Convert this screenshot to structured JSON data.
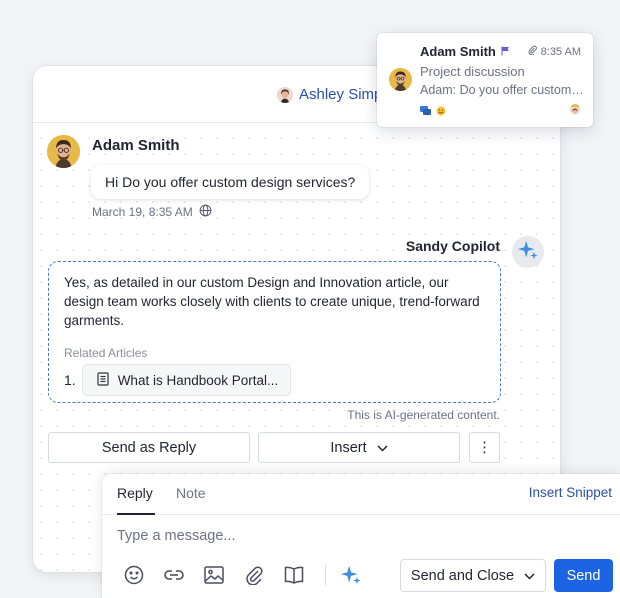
{
  "header": {
    "assignee_name": "Ashley Simp"
  },
  "conversation": {
    "customer": {
      "name": "Adam Smith",
      "message": "Hi Do you offer custom design services?",
      "timestamp": "March 19, 8:35 AM"
    },
    "copilot": {
      "name": "Sandy Copilot",
      "response": "Yes, as detailed in our custom Design and Innovation article, our design team works closely with clients to create unique, trend-forward garments.",
      "related_label": "Related Articles",
      "related_articles": [
        {
          "number": "1.",
          "title": "What is Handbook Portal..."
        }
      ],
      "ai_note": "This is AI-generated content."
    },
    "actions": {
      "send_as_reply": "Send as Reply",
      "insert": "Insert",
      "more": "⋮"
    }
  },
  "notification": {
    "name": "Adam Smith",
    "time": "8:35 AM",
    "subject": "Project discussion",
    "preview": "Adam: Do you offer custom design services?"
  },
  "composer": {
    "tabs": {
      "reply": "Reply",
      "note": "Note"
    },
    "insert_snippet": "Insert Snippet",
    "placeholder": "Type a message...",
    "send_and_close": "Send and Close",
    "send": "Send"
  },
  "colors": {
    "accent": "#1d64e4",
    "link": "#2a4fa6",
    "ai_border": "#4d79c3"
  },
  "icons": [
    "globe-icon",
    "sparkle-icon",
    "document-icon",
    "chevron-down-icon",
    "flag-icon",
    "paperclip-icon",
    "chat-icon",
    "emoji-icon",
    "link-icon",
    "image-icon",
    "book-icon"
  ]
}
